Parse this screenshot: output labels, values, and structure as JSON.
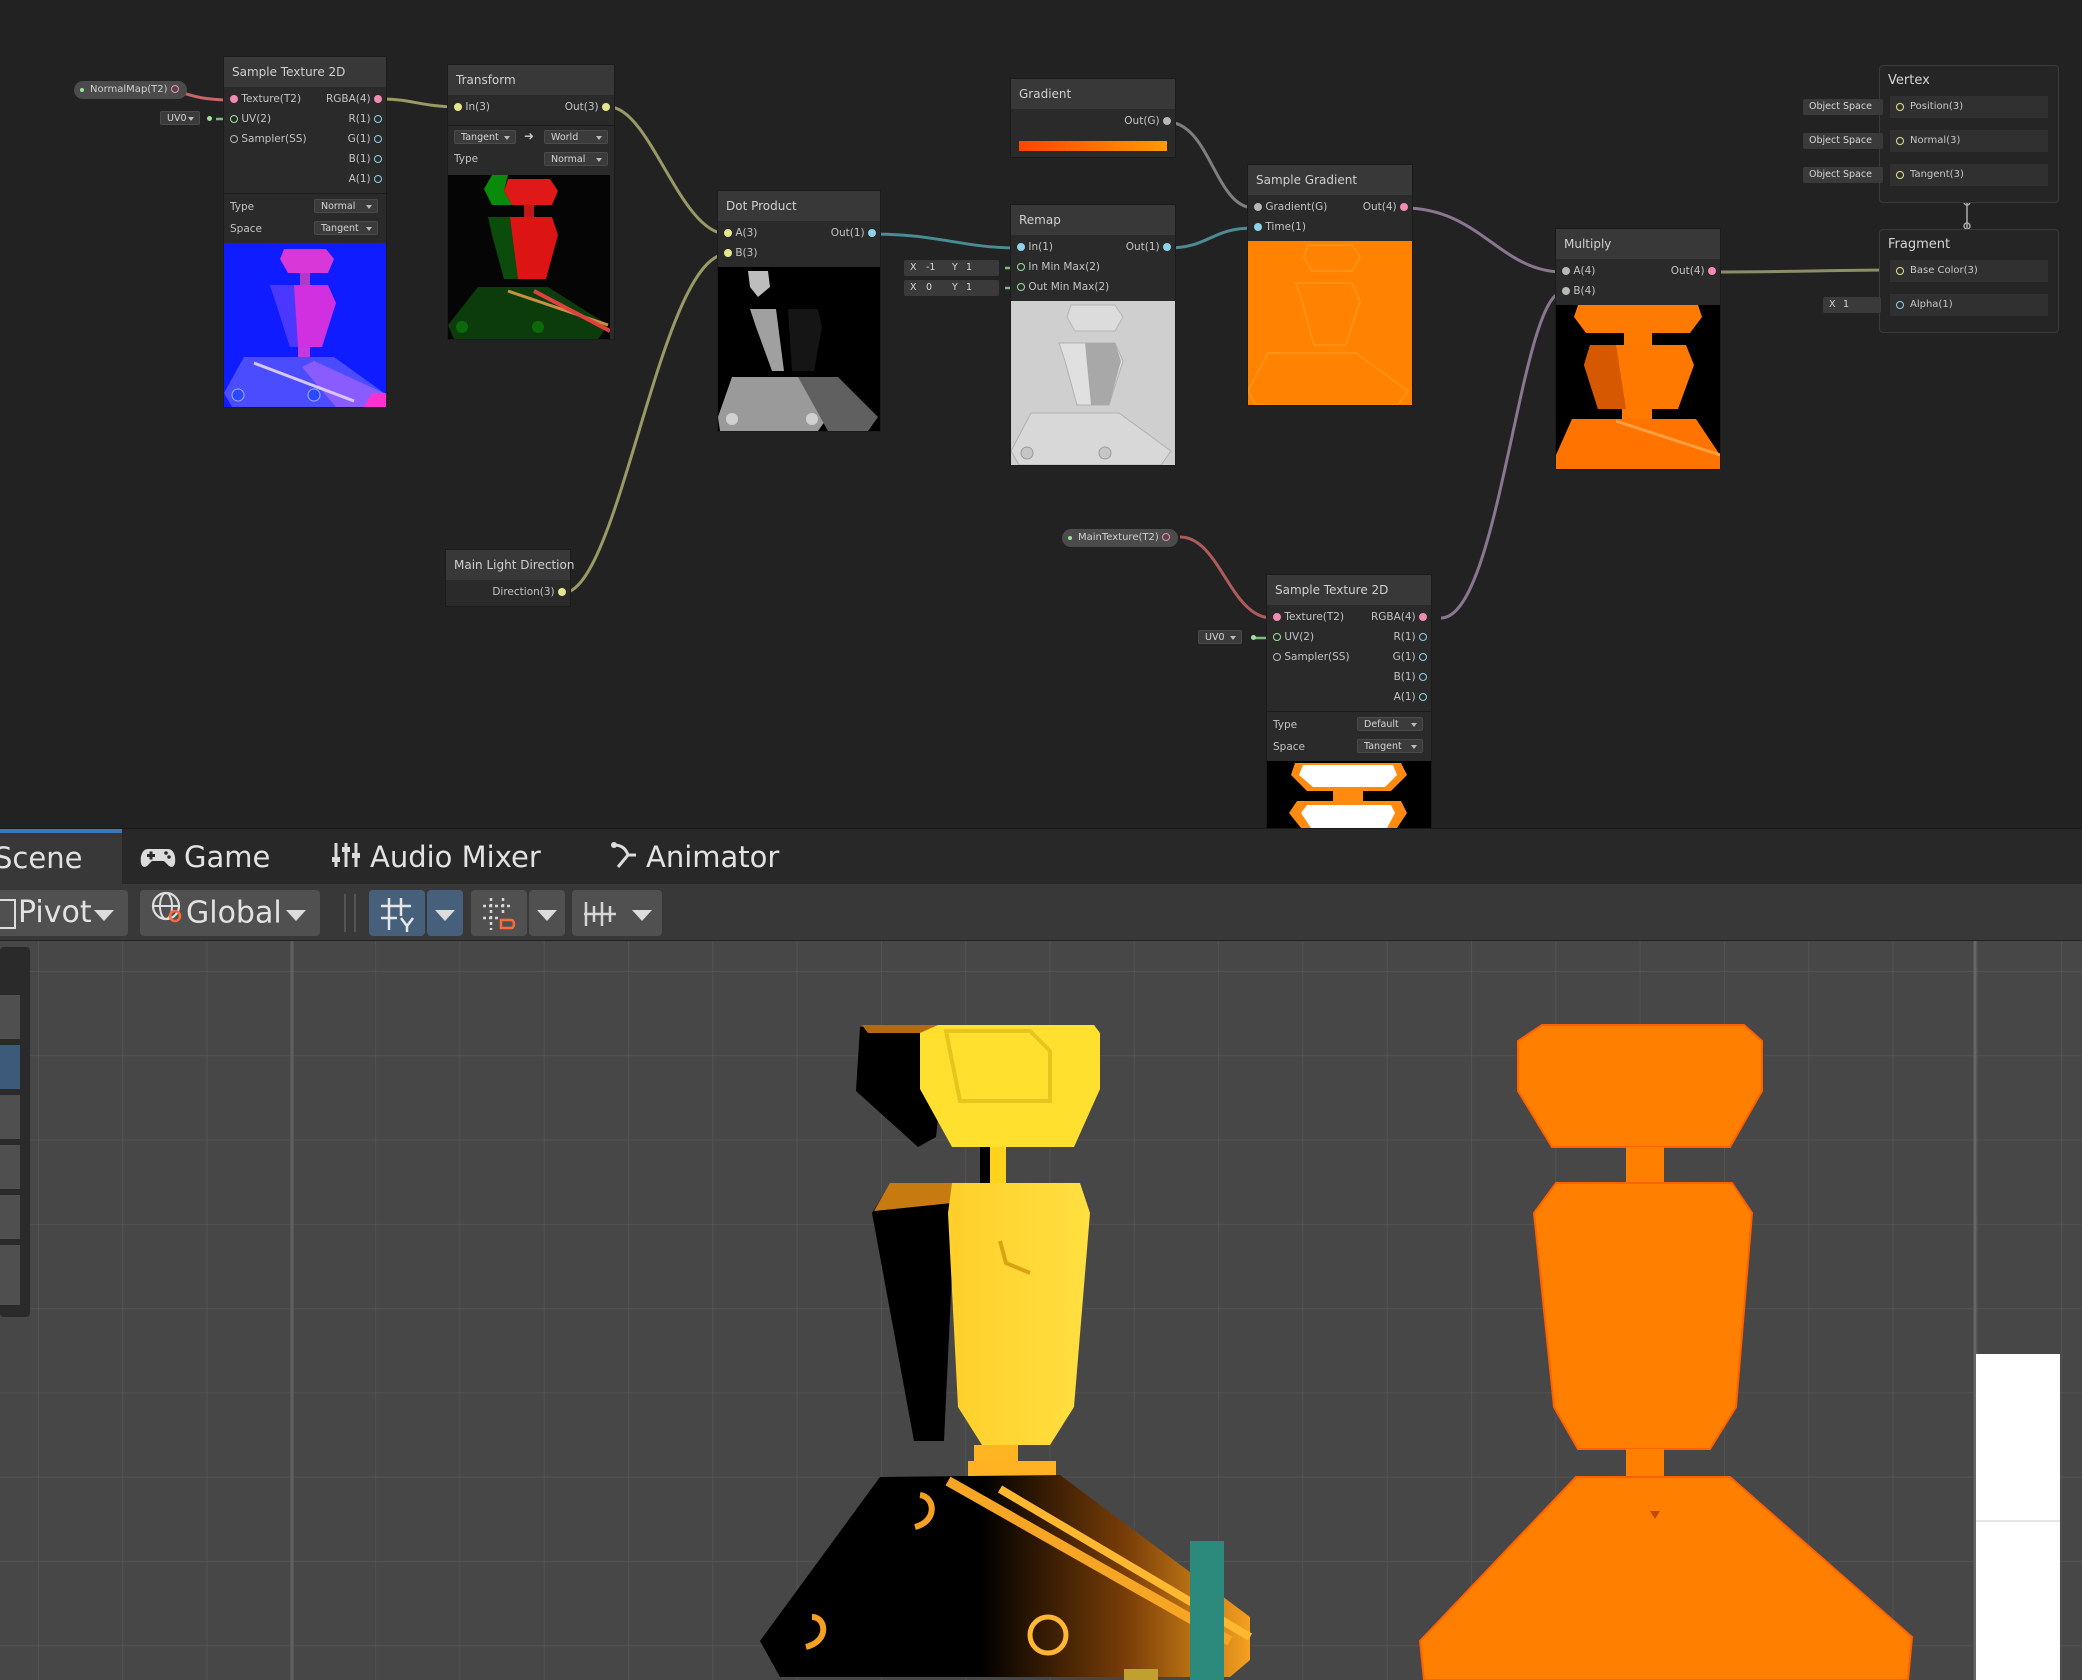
{
  "graph": {
    "properties": {
      "normal_map": "NormalMap(T2)",
      "main_texture": "MainTexture(T2)"
    },
    "uv_selector": "UV0",
    "sample_texture_normal": {
      "title": "Sample Texture 2D",
      "inputs": [
        "Texture(T2)",
        "UV(2)",
        "Sampler(SS)"
      ],
      "outputs": [
        "RGBA(4)",
        "R(1)",
        "G(1)",
        "B(1)",
        "A(1)"
      ],
      "type_label": "Type",
      "type_value": "Normal",
      "space_label": "Space",
      "space_value": "Tangent"
    },
    "transform": {
      "title": "Transform",
      "input": "In(3)",
      "output": "Out(3)",
      "from": "Tangent",
      "to": "World",
      "type_label": "Type",
      "type_value": "Normal"
    },
    "main_light": {
      "title": "Main Light Direction",
      "output": "Direction(3)"
    },
    "dot_product": {
      "title": "Dot Product",
      "inputs": [
        "A(3)",
        "B(3)"
      ],
      "output": "Out(1)"
    },
    "gradient": {
      "title": "Gradient",
      "output": "Out(G)"
    },
    "remap": {
      "title": "Remap",
      "inputs": [
        "In(1)",
        "In Min Max(2)",
        "Out Min Max(2)"
      ],
      "output": "Out(1)",
      "in_min_max": {
        "x_label": "X",
        "x": "-1",
        "y_label": "Y",
        "y": "1"
      },
      "out_min_max": {
        "x_label": "X",
        "x": "0",
        "y_label": "Y",
        "y": "1"
      }
    },
    "sample_gradient": {
      "title": "Sample Gradient",
      "inputs": [
        "Gradient(G)",
        "Time(1)"
      ],
      "output": "Out(4)"
    },
    "multiply": {
      "title": "Multiply",
      "inputs": [
        "A(4)",
        "B(4)"
      ],
      "output": "Out(4)"
    },
    "sample_texture_main": {
      "title": "Sample Texture 2D",
      "inputs": [
        "Texture(T2)",
        "UV(2)",
        "Sampler(SS)"
      ],
      "outputs": [
        "RGBA(4)",
        "R(1)",
        "G(1)",
        "B(1)",
        "A(1)"
      ],
      "type_label": "Type",
      "type_value": "Default",
      "space_label": "Space",
      "space_value": "Tangent"
    },
    "vertex": {
      "title": "Vertex",
      "slots": [
        "Position(3)",
        "Normal(3)",
        "Tangent(3)"
      ],
      "space_label": "Object Space"
    },
    "fragment": {
      "title": "Fragment",
      "slots": [
        "Base Color(3)",
        "Alpha(1)"
      ],
      "alpha_x_label": "X",
      "alpha_x": "1"
    }
  },
  "tabs": [
    {
      "label": "Scene",
      "icon": "scene-icon",
      "active": true
    },
    {
      "label": "Game",
      "icon": "gamepad-icon",
      "active": false
    },
    {
      "label": "Audio Mixer",
      "icon": "sliders-icon",
      "active": false
    },
    {
      "label": "Animator",
      "icon": "animator-icon",
      "active": false
    }
  ],
  "toolbar": {
    "pivot_label": "Pivot",
    "global_label": "Global",
    "icons": [
      "grid-snap-icon",
      "increment-snap-icon",
      "align-icon"
    ]
  },
  "colors": {
    "orange": "#ff7f00",
    "yellow": "#ffd726",
    "graph_bg": "#222223",
    "node_header": "#383838",
    "active_tab_accent": "#3a79bb"
  }
}
